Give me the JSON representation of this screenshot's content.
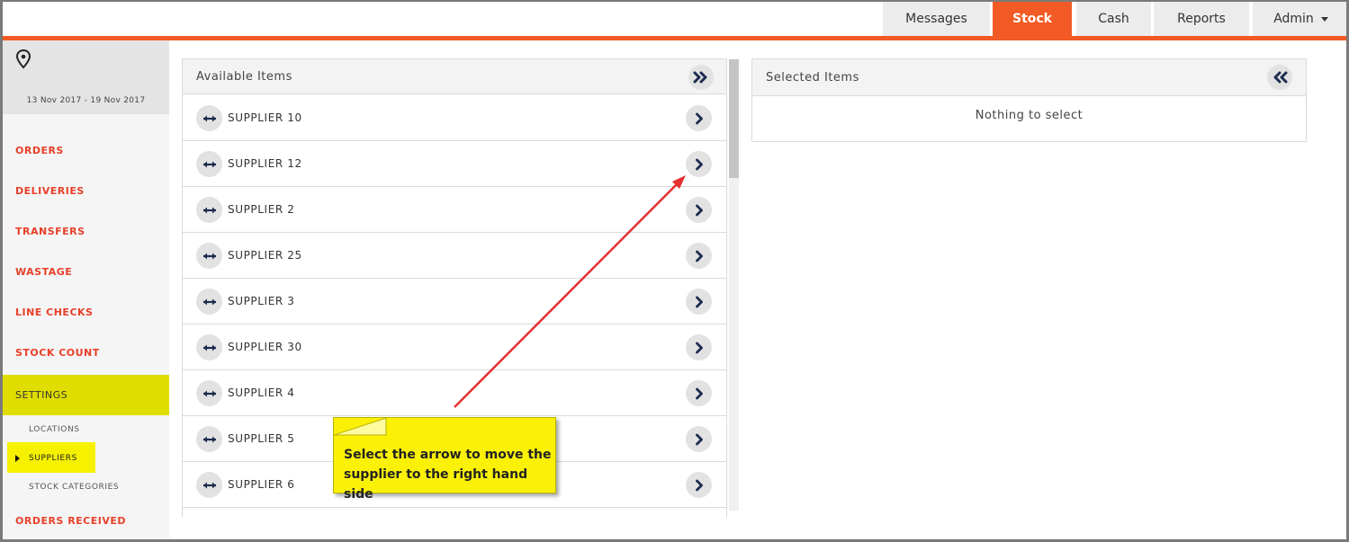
{
  "topnav": {
    "tabs": [
      {
        "label": "Messages",
        "active": false
      },
      {
        "label": "Stock",
        "active": true
      },
      {
        "label": "Cash",
        "active": false
      },
      {
        "label": "Reports",
        "active": false
      },
      {
        "label": "Admin",
        "active": false
      }
    ],
    "accent_color": "#f15a24"
  },
  "sidebar": {
    "date_range": "13 Nov 2017 - 19 Nov 2017",
    "items": [
      {
        "label": "ORDERS"
      },
      {
        "label": "DELIVERIES"
      },
      {
        "label": "TRANSFERS"
      },
      {
        "label": "WASTAGE"
      },
      {
        "label": "LINE CHECKS"
      },
      {
        "label": "STOCK COUNT"
      },
      {
        "label": "SETTINGS",
        "active": true
      },
      {
        "label": "ORDERS RECEIVED"
      }
    ],
    "sub_items": [
      {
        "label": "LOCATIONS"
      },
      {
        "label": "SUPPLIERS",
        "highlighted": true
      },
      {
        "label": "STOCK CATEGORIES"
      }
    ],
    "highlight_color": "#e0dd00"
  },
  "available": {
    "title": "Available Items",
    "items": [
      {
        "label": "SUPPLIER 10"
      },
      {
        "label": "SUPPLIER 12"
      },
      {
        "label": "SUPPLIER 2"
      },
      {
        "label": "SUPPLIER 25"
      },
      {
        "label": "SUPPLIER 3"
      },
      {
        "label": "SUPPLIER 30"
      },
      {
        "label": "SUPPLIER 4"
      },
      {
        "label": "SUPPLIER 5"
      },
      {
        "label": "SUPPLIER 6"
      }
    ]
  },
  "selected": {
    "title": "Selected Items",
    "empty_message": "Nothing to select"
  },
  "callout": {
    "text": "Select the arrow to move the supplier to the right hand side",
    "color": "#fbf107",
    "arrow_color": "#e53030"
  }
}
